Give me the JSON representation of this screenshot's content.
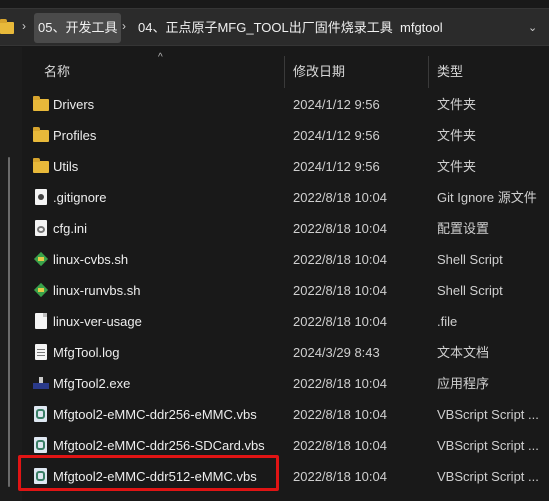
{
  "breadcrumb": {
    "items": [
      "05、开发工具",
      "04、正点原子MFG_TOOL出厂固件烧录工具",
      "mfgtool"
    ],
    "separator": "›",
    "more_icon": "chevron-down-icon"
  },
  "columns": {
    "name": "名称",
    "date": "修改日期",
    "type": "类型"
  },
  "files": [
    {
      "name": "Drivers",
      "date": "2024/1/12 9:56",
      "type": "文件夹",
      "icon": "folder-icon"
    },
    {
      "name": "Profiles",
      "date": "2024/1/12 9:56",
      "type": "文件夹",
      "icon": "folder-icon"
    },
    {
      "name": "Utils",
      "date": "2024/1/12 9:56",
      "type": "文件夹",
      "icon": "folder-icon"
    },
    {
      "name": ".gitignore",
      "date": "2022/8/18 10:04",
      "type": "Git Ignore 源文件",
      "icon": "git-file-icon"
    },
    {
      "name": "cfg.ini",
      "date": "2022/8/18 10:04",
      "type": "配置设置",
      "icon": "settings-file-icon"
    },
    {
      "name": "linux-cvbs.sh",
      "date": "2022/8/18 10:04",
      "type": "Shell Script",
      "icon": "shell-script-icon"
    },
    {
      "name": "linux-runvbs.sh",
      "date": "2022/8/18 10:04",
      "type": "Shell Script",
      "icon": "shell-script-icon"
    },
    {
      "name": "linux-ver-usage",
      "date": "2022/8/18 10:04",
      "type": ".file",
      "icon": "file-icon"
    },
    {
      "name": "MfgTool.log",
      "date": "2024/3/29 8:43",
      "type": "文本文档",
      "icon": "text-file-icon"
    },
    {
      "name": "MfgTool2.exe",
      "date": "2022/8/18 10:04",
      "type": "应用程序",
      "icon": "application-icon"
    },
    {
      "name": "Mfgtool2-eMMC-ddr256-eMMC.vbs",
      "date": "2022/8/18 10:04",
      "type": "VBScript Script ...",
      "icon": "vbscript-icon"
    },
    {
      "name": "Mfgtool2-eMMC-ddr256-SDCard.vbs",
      "date": "2022/8/18 10:04",
      "type": "VBScript Script ...",
      "icon": "vbscript-icon"
    },
    {
      "name": "Mfgtool2-eMMC-ddr512-eMMC.vbs",
      "date": "2022/8/18 10:04",
      "type": "VBScript Script ...",
      "icon": "vbscript-icon"
    }
  ],
  "highlight_color": "#e01414"
}
